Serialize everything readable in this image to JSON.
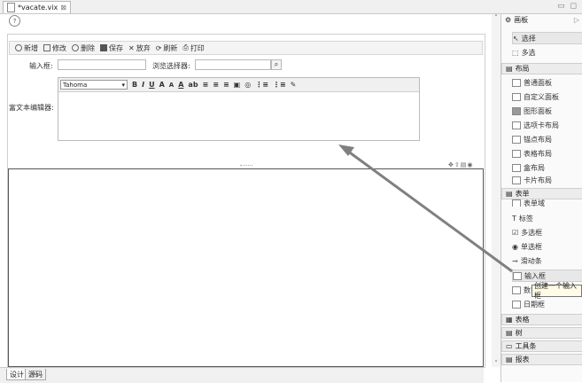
{
  "editor": {
    "tab_title": "*vacate.vix",
    "close_glyph": "⊠",
    "help_glyph": "?"
  },
  "window": {
    "minimize_glyph": "▭",
    "maximize_glyph": "◻"
  },
  "toolbar": {
    "add": "新增",
    "edit": "修改",
    "delete": "删除",
    "save": "保存",
    "discard": "放弃",
    "refresh": "刷新",
    "print": "打印"
  },
  "form": {
    "input_label": "输入框:",
    "input_value": "",
    "browse_label": "浏览选择器:",
    "browse_value": "",
    "rte_label": "富文本编辑器:",
    "rte_font": "Tahoma"
  },
  "rte_tools": [
    "B",
    "I",
    "U",
    "A",
    "A",
    "A",
    "ab",
    "≡",
    "≡",
    "≡",
    "▣",
    "◎",
    "⋮≡",
    "⋮≡",
    "✎"
  ],
  "bottom_tabs": {
    "design": "设计",
    "source": "源码"
  },
  "palette": {
    "header": "画板",
    "tools": {
      "select": "选择",
      "multi_select": "多选"
    },
    "sections": {
      "layout": "布局",
      "form": "表单",
      "grid": "表格",
      "tree": "树",
      "toolbar": "工具条",
      "report": "报表"
    },
    "layout_items": [
      "普通面板",
      "自定义面板",
      "图形面板",
      "选项卡布局",
      "锚点布局",
      "表格布局",
      "盒布局",
      "卡片布局"
    ],
    "form_items": [
      "表单域",
      "标签",
      "多选框",
      "单选框",
      "滑动条",
      "输入框",
      "数字框",
      "日期框"
    ],
    "tooltip": "创建一个输入框"
  },
  "colors": {
    "arrow": "#808080",
    "canvas_border": "#555555"
  }
}
